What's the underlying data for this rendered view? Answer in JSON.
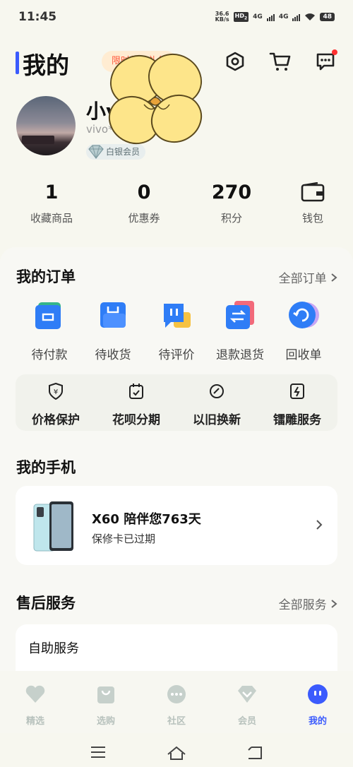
{
  "status": {
    "time": "11:45",
    "speed_value": "36.6",
    "speed_unit": "KB/s",
    "hd": "HD",
    "hd_sub": "2",
    "net1": "4G",
    "net2": "4G",
    "battery": "48"
  },
  "header": {
    "title": "我的",
    "promo_badge": "限时新人礼包",
    "icons": [
      "settings-hex-icon",
      "cart-icon",
      "message-icon"
    ]
  },
  "profile": {
    "name": "小vi",
    "account": "vivo******413",
    "member_level": "白银会员"
  },
  "stats": [
    {
      "value": "1",
      "label": "收藏商品"
    },
    {
      "value": "0",
      "label": "优惠券"
    },
    {
      "value": "270",
      "label": "积分"
    },
    {
      "value": "",
      "label": "钱包",
      "icon": "wallet-icon"
    }
  ],
  "orders": {
    "title": "我的订单",
    "link": "全部订单",
    "items": [
      {
        "label": "待付款",
        "icon": "pending-payment-icon"
      },
      {
        "label": "待收货",
        "icon": "pending-receipt-icon"
      },
      {
        "label": "待评价",
        "icon": "pending-review-icon"
      },
      {
        "label": "退款退货",
        "icon": "refund-icon"
      },
      {
        "label": "回收单",
        "icon": "recycle-order-icon"
      }
    ]
  },
  "services": [
    {
      "label": "价格保护",
      "icon": "price-protect-icon"
    },
    {
      "label": "花呗分期",
      "icon": "installment-icon"
    },
    {
      "label": "以旧换新",
      "icon": "trade-in-icon"
    },
    {
      "label": "镭雕服务",
      "icon": "engraving-icon"
    }
  ],
  "my_phone": {
    "title": "我的手机",
    "model_line": "X60 陪伴您763天",
    "warranty": "保修卡已过期"
  },
  "after_sales": {
    "title": "售后服务",
    "link": "全部服务",
    "self_service": "自助服务"
  },
  "nav": [
    {
      "label": "精选",
      "active": false
    },
    {
      "label": "选购",
      "active": false
    },
    {
      "label": "社区",
      "active": false
    },
    {
      "label": "会员",
      "active": false
    },
    {
      "label": "我的",
      "active": true
    }
  ],
  "colors": {
    "accent": "#3b5bfd",
    "background": "#f7f7ef",
    "promo_text": "#ff5a3c",
    "sticker_fill": "#fde58a"
  }
}
